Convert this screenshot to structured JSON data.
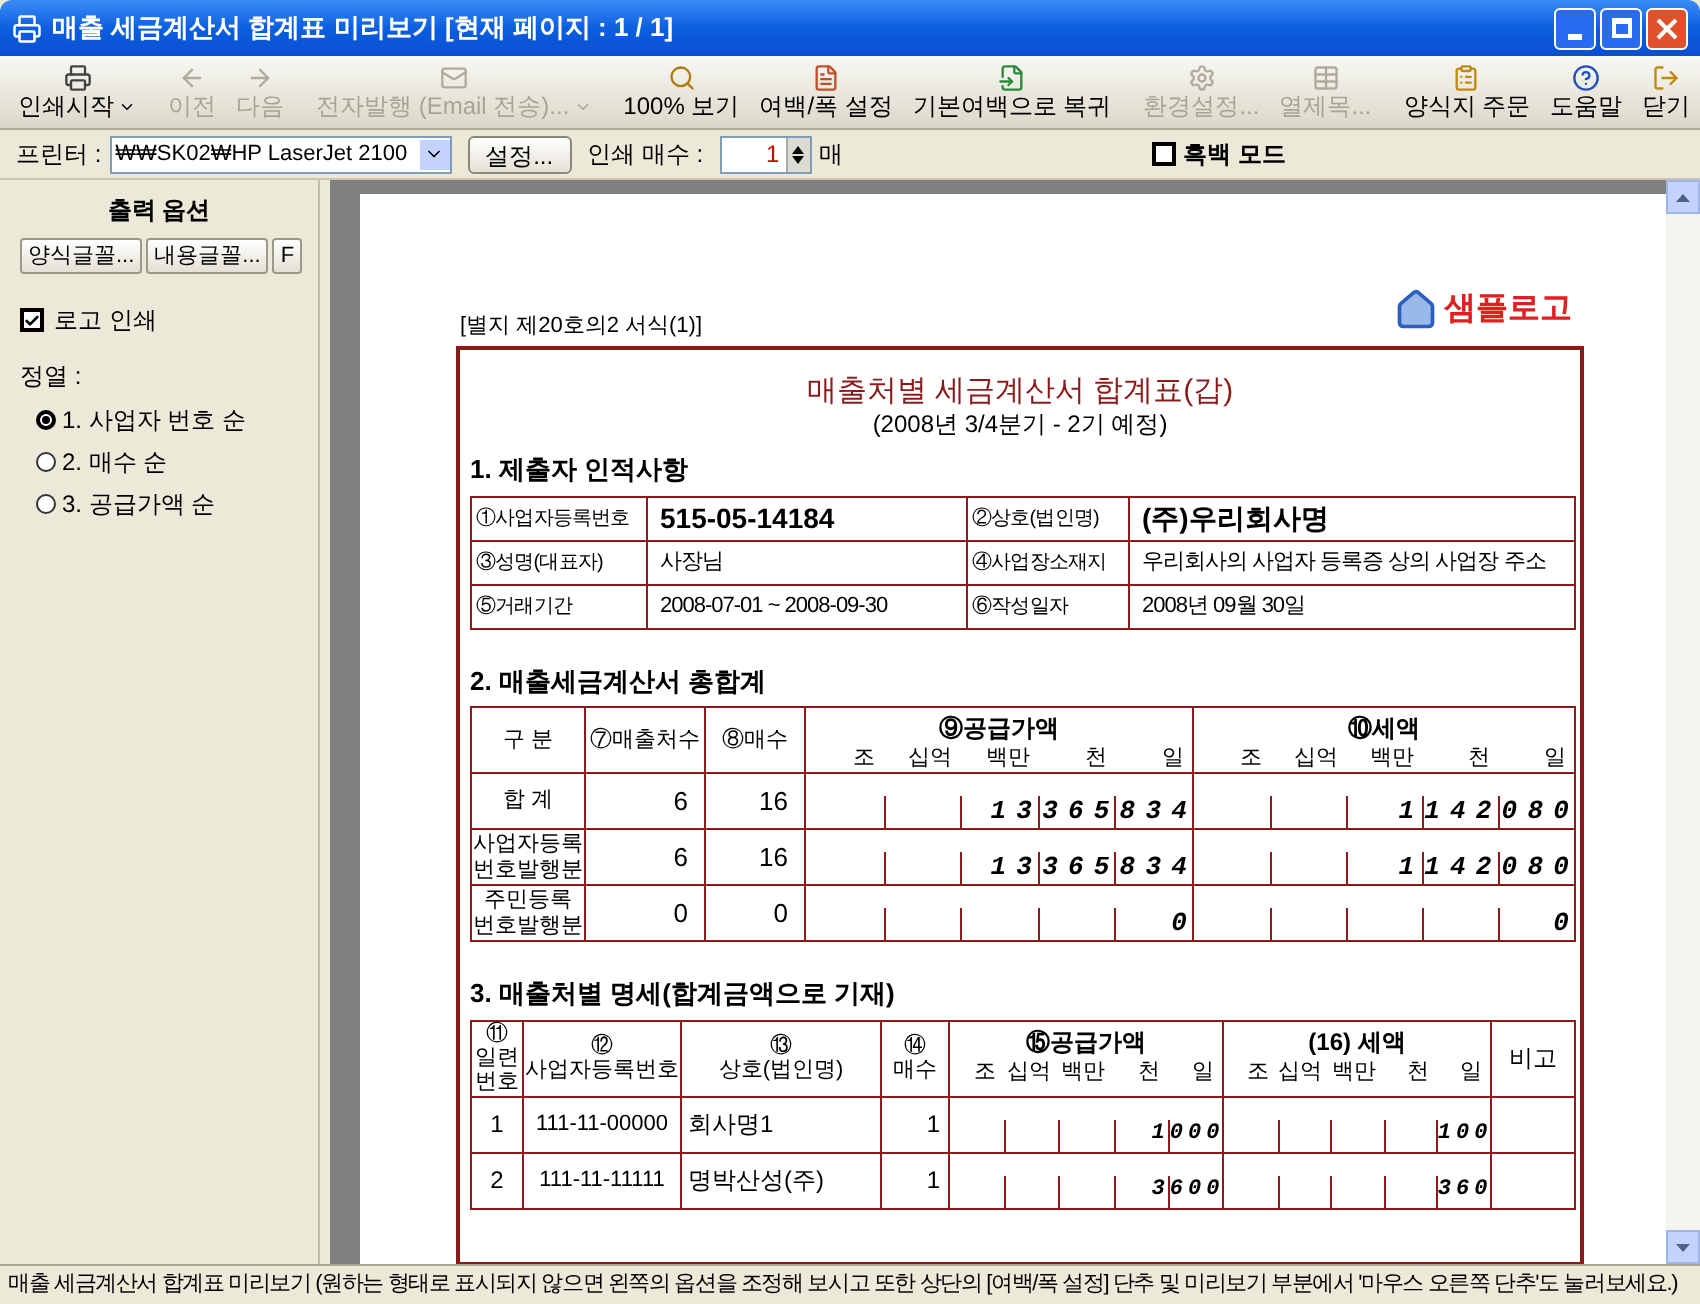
{
  "window": {
    "title": "매출 세금계산서 합계표 미리보기 [현재 페이지 : 1 / 1]"
  },
  "toolbar": [
    {
      "kind": "print",
      "label": "인쇄시작",
      "disabled": false,
      "dropdown": true
    },
    {
      "kind": "prev",
      "label": "이전",
      "disabled": true,
      "dropdown": false
    },
    {
      "kind": "next",
      "label": "다음",
      "disabled": true,
      "dropdown": false
    },
    {
      "kind": "mail",
      "label": "전자발행 (Email 전송)...",
      "disabled": true,
      "dropdown": true
    },
    {
      "kind": "zoom",
      "label": "100% 보기",
      "disabled": false,
      "dropdown": false
    },
    {
      "kind": "margin",
      "label": "여백/폭 설정",
      "disabled": false,
      "dropdown": false
    },
    {
      "kind": "reset",
      "label": "기본여백으로 복귀",
      "disabled": false,
      "dropdown": false
    },
    {
      "kind": "settings",
      "label": "환경설정...",
      "disabled": true,
      "dropdown": false
    },
    {
      "kind": "columns",
      "label": "열제목...",
      "disabled": true,
      "dropdown": false
    },
    {
      "kind": "order",
      "label": "양식지 주문",
      "disabled": false,
      "dropdown": false
    },
    {
      "kind": "help",
      "label": "도움말",
      "disabled": false,
      "dropdown": false
    },
    {
      "kind": "close",
      "label": "닫기",
      "disabled": false,
      "dropdown": false
    }
  ],
  "printer_bar": {
    "printer_label": "프린터 :",
    "printer": "₩₩SK02₩HP LaserJet 2100",
    "setup_button": "설정...",
    "copies_label": "인쇄 매수 :",
    "copies": "1",
    "copies_unit": "매",
    "mono": {
      "label": "흑백 모드",
      "checked": false
    }
  },
  "options": {
    "title": "출력 옵션",
    "buttons": [
      "양식글꼴...",
      "내용글꼴...",
      "F"
    ],
    "logo": {
      "label": "로고 인쇄",
      "checked": true
    },
    "sort_label": "정열 :",
    "sort": [
      {
        "label": "1. 사업자 번호 순",
        "selected": true
      },
      {
        "label": "2. 매수 순",
        "selected": false
      },
      {
        "label": "3. 공급가액 순",
        "selected": false
      }
    ]
  },
  "document": {
    "form_no": "[별지 제20호의2 서식(1)]",
    "logo": "샘플로고",
    "title": "매출처별 세금계산서 합계표(갑)",
    "subtitle": "(2008년 3/4분기 - 2기 예정)",
    "section1": {
      "heading": "1. 제출자 인적사항",
      "rows": [
        {
          "bold": true,
          "cells": [
            "①사업자등록번호",
            "515-05-14184",
            "②상호(법인명)",
            "(주)우리회사명"
          ]
        },
        {
          "bold": false,
          "cells": [
            "③성명(대표자)",
            "사장님",
            "④사업장소재지",
            "우리회사의 사업자 등록증 상의 사업장 주소"
          ]
        },
        {
          "bold": false,
          "cells": [
            "⑤거래기간",
            "2008-07-01 ~ 2008-09-30",
            "⑥작성일자",
            "2008년 09월 30일"
          ]
        }
      ]
    },
    "section2": {
      "heading": "2. 매출세금계산서 총합계",
      "columns": [
        "구 분",
        "⑦매출처수",
        "⑧매수"
      ],
      "amount_columns": [
        {
          "title": "⑨공급가액",
          "units": [
            "조",
            "십억",
            "백만",
            "천",
            "일"
          ]
        },
        {
          "title": "⑩세액",
          "units": [
            "조",
            "십억",
            "백만",
            "천",
            "일"
          ]
        }
      ],
      "rows": [
        {
          "label": "합 계",
          "count": "6",
          "sheets": "16",
          "supply": "13365834",
          "tax": "1142080"
        },
        {
          "label": "사업자등록\n번호발행분",
          "count": "6",
          "sheets": "16",
          "supply": "13365834",
          "tax": "1142080"
        },
        {
          "label": "주민등록\n번호발행분",
          "count": "0",
          "sheets": "0",
          "supply": "0",
          "tax": "0"
        }
      ]
    },
    "section3": {
      "heading": "3. 매출처별 명세(합계금액으로 기재)",
      "columns": [
        "⑪\n일련\n번호",
        "⑫\n사업자등록번호",
        "⑬\n상호(법인명)",
        "⑭\n매수"
      ],
      "amount_columns": [
        {
          "title": "⑮공급가액",
          "units": [
            "조",
            "십억",
            "백만",
            "천",
            "일"
          ]
        },
        {
          "title": "(16) 세액",
          "units": [
            "조",
            "십억",
            "백만",
            "천",
            "일"
          ]
        }
      ],
      "note_column": "비고",
      "rows": [
        {
          "no": "1",
          "reg_no": "111-11-00000",
          "name": "회사명1",
          "sheets": "1",
          "supply": "1000",
          "tax": "100"
        },
        {
          "no": "2",
          "reg_no": "111-11-11111",
          "name": "명박산성(주)",
          "sheets": "1",
          "supply": "3600",
          "tax": "360"
        }
      ]
    }
  },
  "status_bar": "매출 세금계산서 합계표 미리보기 (원하는 형태로 표시되지 않으면 왼쪽의 옵션을 조정해 보시고 또한 상단의 [여백/폭 설정] 단추 및 미리보기 부분에서 '마우스 오른쪽 단추'도 눌러보세요.)"
}
